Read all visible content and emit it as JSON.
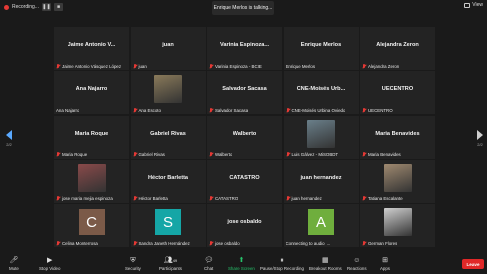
{
  "topbar": {
    "recording_label": "Recording...",
    "pause_icon": "pause-icon",
    "stop_icon": "stop-icon",
    "talking_text": "Enrique Merlos is talking...",
    "view_label": "View"
  },
  "pager": {
    "left_page": "2/2",
    "right_page": "2/2"
  },
  "tiles": [
    {
      "display": "Jaime Antonio V...",
      "label": "Jaime Antonio Vásquez López",
      "muted": true
    },
    {
      "display": "juan",
      "label": "juan",
      "muted": true
    },
    {
      "display": "Varinia  Espinoza...",
      "label": "Varinia Espinoza - BCIE",
      "muted": true
    },
    {
      "display": "Enrique Merlos",
      "label": "Enrique Merlos",
      "muted": false
    },
    {
      "display": "Alejandra Zeron",
      "label": "Alejandra Zeron",
      "muted": true
    },
    {
      "display": "Ana Najarro",
      "label": "Ana Najarro",
      "muted": false
    },
    {
      "display": "",
      "label": "Ana Escoto",
      "muted": true,
      "avatar": "photo-woman-hat",
      "color": "#8a7a5a"
    },
    {
      "display": "Salvador Sacasa",
      "label": "Salvador Sacasa",
      "muted": true
    },
    {
      "display": "CNE-Moisés  Urb...",
      "label": "CNE-Moisés Urbina Oviedo",
      "muted": true
    },
    {
      "display": "UECENTRO",
      "label": "UECENTRO",
      "muted": true
    },
    {
      "display": "Maria Roque",
      "label": "Maria Roque",
      "muted": true
    },
    {
      "display": "Gabriel Rivas",
      "label": "Gabriel Rivas",
      "muted": true
    },
    {
      "display": "Walberto",
      "label": "Walberto",
      "muted": true
    },
    {
      "display": "",
      "label": "Luis Gálvez - MiSOBDT",
      "muted": true,
      "avatar": "photo-man-glasses",
      "color": "#6a7f8a"
    },
    {
      "display": "Maria Benavides",
      "label": "Maria Benavides",
      "muted": true
    },
    {
      "display": "",
      "label": "jose maria mejia espinoza",
      "muted": true,
      "avatar": "photo-man-standing",
      "color": "#8a4a4a"
    },
    {
      "display": "Héctor Barletta",
      "label": "Héctor Barletta",
      "muted": true
    },
    {
      "display": "CATASTRO",
      "label": "CATASTRO",
      "muted": true
    },
    {
      "display": "juan hernandez",
      "label": "juan hernandez",
      "muted": true
    },
    {
      "display": "",
      "label": "Tatiana Escalante",
      "muted": true,
      "avatar": "photo-woman",
      "color": "#a08a70"
    },
    {
      "display": "",
      "label": "Celina Monterrosa",
      "muted": true,
      "letter": "C",
      "color": "#7b5a48"
    },
    {
      "display": "",
      "label": "Sandra Janeth Hernández",
      "muted": true,
      "letter": "S",
      "color": "#15a6a6"
    },
    {
      "display": "jose osbaldo",
      "label": "jose osbaldo",
      "muted": true
    },
    {
      "display": "",
      "label": "Connecting to audio",
      "muted": false,
      "connecting": true,
      "letter": "A",
      "color": "#6fae3d"
    },
    {
      "display": "",
      "label": "German Flores",
      "muted": true,
      "avatar": "photo-man-suit",
      "color": "#cfcfcf"
    }
  ],
  "toolbar": {
    "mute": {
      "label": "Mute",
      "icon": "microphone-icon"
    },
    "stop_video": {
      "label": "Stop Video",
      "icon": "video-camera-icon"
    },
    "security": {
      "label": "Security",
      "icon": "shield-icon"
    },
    "participants": {
      "label": "Participants",
      "icon": "participants-icon",
      "count": "49"
    },
    "chat": {
      "label": "Chat",
      "icon": "chat-icon"
    },
    "share_screen": {
      "label": "Share Screen",
      "icon": "share-screen-icon"
    },
    "recording": {
      "label": "Pause/Stop Recording",
      "icon": "recording-icon"
    },
    "breakout": {
      "label": "Breakout Rooms",
      "icon": "breakout-rooms-icon"
    },
    "reactions": {
      "label": "Reactions",
      "icon": "reactions-icon"
    },
    "apps": {
      "label": "Apps",
      "icon": "apps-icon"
    },
    "leave": "Leave"
  },
  "colors": {
    "background": "#1a1a1a",
    "tile": "#232323",
    "accent_green": "#26c26b",
    "leave_red": "#e02828",
    "muted_red": "#e53935",
    "pager_blue": "#5aa9ff"
  }
}
